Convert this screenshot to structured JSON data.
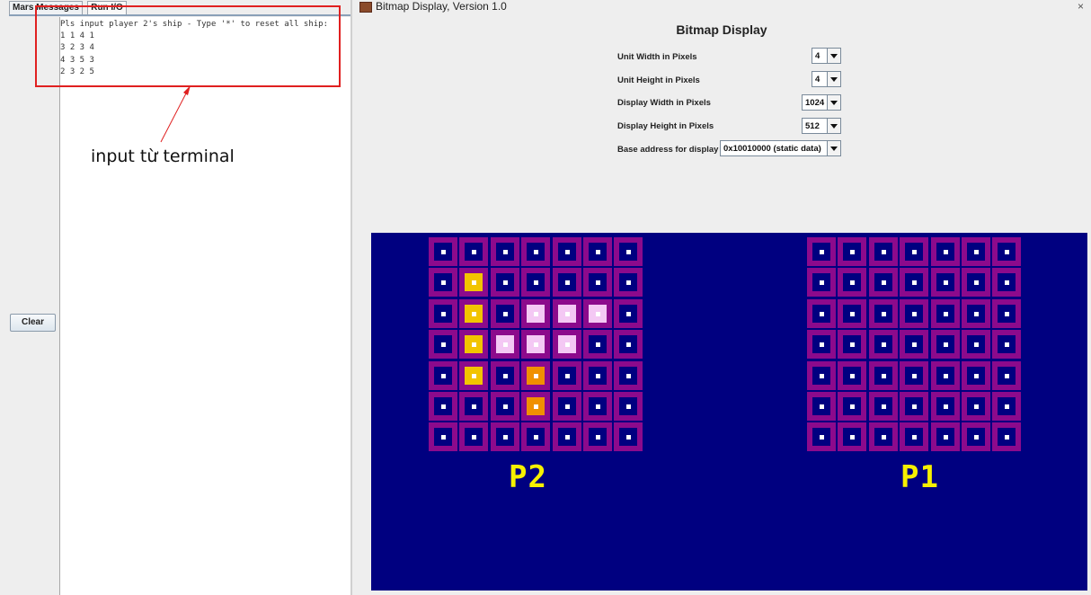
{
  "mars": {
    "tabs": [
      "Mars Messages",
      "Run I/O"
    ],
    "clear_label": "Clear",
    "console_lines": [
      "Pls input player 2's ship - Type '*' to reset all ship:",
      "1 1 4 1",
      "3 2 3 4",
      "4 3 5 3",
      "2 3 2 5"
    ],
    "annotation": "input từ terminal"
  },
  "bitmap": {
    "window_title": "Bitmap Display, Version 1.0",
    "close_glyph": "×",
    "tool_title": "Bitmap Display",
    "settings": [
      {
        "label": "Unit Width in Pixels",
        "value": "4"
      },
      {
        "label": "Unit Height in Pixels",
        "value": "4"
      },
      {
        "label": "Display Width in Pixels",
        "value": "1024"
      },
      {
        "label": "Display Height in Pixels",
        "value": "512"
      },
      {
        "label": "Base address for display",
        "value": "0x10010000 (static data)"
      }
    ],
    "colors": {
      "background": "#000080",
      "border": "#8c0a8c",
      "dot": "#ffffff",
      "ship_yellow": "#f2c400",
      "ship_pink": "#f4c8f4",
      "ship_orange": "#f09000",
      "label": "#f6f000"
    },
    "boards": [
      {
        "label": "P2",
        "grid": [
          [
            "empty",
            "empty",
            "empty",
            "empty",
            "empty",
            "empty",
            "empty"
          ],
          [
            "empty",
            "yellow",
            "empty",
            "empty",
            "empty",
            "empty",
            "empty"
          ],
          [
            "empty",
            "yellow",
            "empty",
            "pink",
            "pink",
            "pink",
            "empty"
          ],
          [
            "empty",
            "yellow",
            "pink",
            "pink",
            "pink",
            "empty",
            "empty"
          ],
          [
            "empty",
            "yellow",
            "empty",
            "orange",
            "empty",
            "empty",
            "empty"
          ],
          [
            "empty",
            "empty",
            "empty",
            "orange",
            "empty",
            "empty",
            "empty"
          ],
          [
            "empty",
            "empty",
            "empty",
            "empty",
            "empty",
            "empty",
            "empty"
          ]
        ]
      },
      {
        "label": "P1",
        "grid": [
          [
            "empty",
            "empty",
            "empty",
            "empty",
            "empty",
            "empty",
            "empty"
          ],
          [
            "empty",
            "empty",
            "empty",
            "empty",
            "empty",
            "empty",
            "empty"
          ],
          [
            "empty",
            "empty",
            "empty",
            "empty",
            "empty",
            "empty",
            "empty"
          ],
          [
            "empty",
            "empty",
            "empty",
            "empty",
            "empty",
            "empty",
            "empty"
          ],
          [
            "empty",
            "empty",
            "empty",
            "empty",
            "empty",
            "empty",
            "empty"
          ],
          [
            "empty",
            "empty",
            "empty",
            "empty",
            "empty",
            "empty",
            "empty"
          ],
          [
            "empty",
            "empty",
            "empty",
            "empty",
            "empty",
            "empty",
            "empty"
          ]
        ]
      }
    ]
  }
}
